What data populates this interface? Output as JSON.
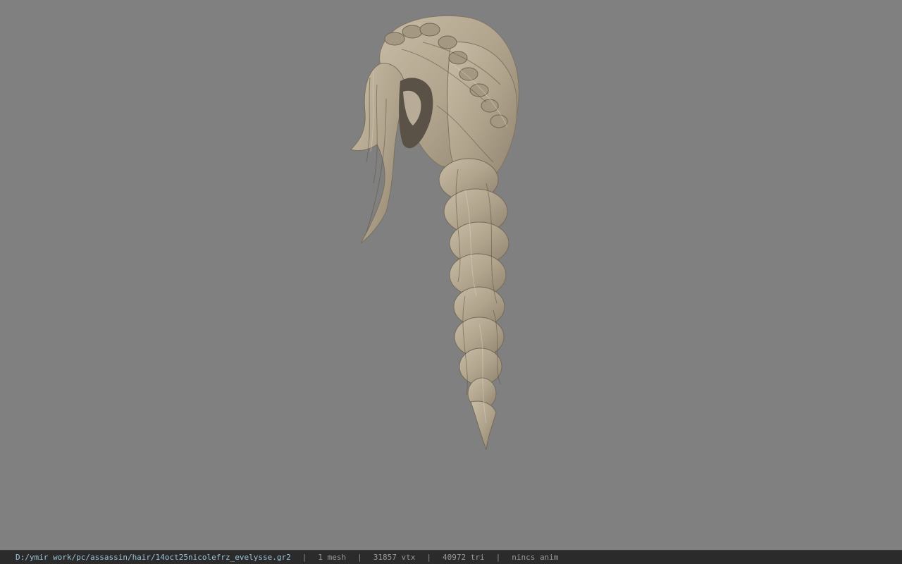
{
  "window": {
    "background_color": "#808080",
    "model_color": "#b3a690"
  },
  "statusbar": {
    "file_path": "D:/ymir work/pc/assassin/hair/14oct25nicolefrz_evelysse.gr2",
    "separator": "|",
    "mesh_count": "1 mesh",
    "vertex_count": "31857 vtx",
    "triangle_count": "40972 tri",
    "animation": "nincs anim"
  }
}
